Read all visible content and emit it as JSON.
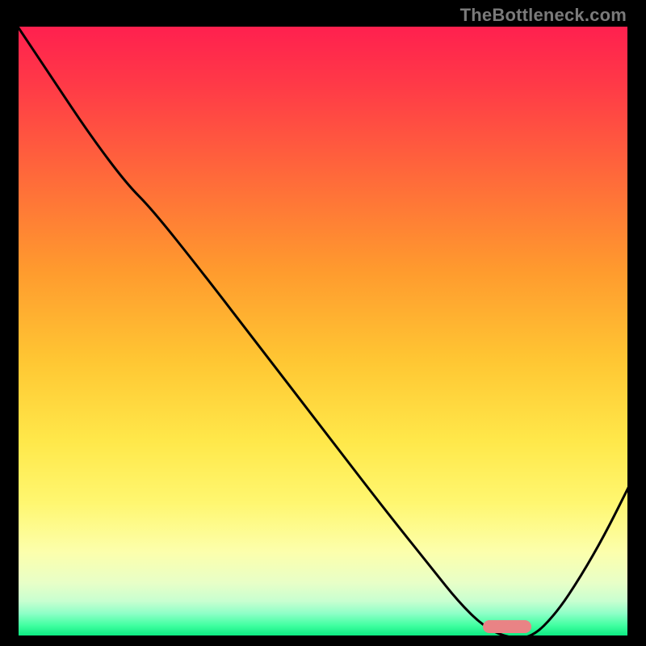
{
  "watermark": "TheBottleneck.com",
  "colors": {
    "curve": "#000000",
    "marker": "#e98385",
    "gradient_top": "#ff1f4f",
    "gradient_bottom": "#00e67a"
  },
  "chart_data": {
    "type": "line",
    "title": "",
    "xlabel": "",
    "ylabel": "",
    "xlim": [
      0,
      100
    ],
    "ylim": [
      0,
      100
    ],
    "grid": false,
    "legend": null,
    "annotations": [
      "TheBottleneck.com"
    ],
    "series": [
      {
        "name": "bottleneck-curve",
        "x": [
          0,
          6,
          12,
          18,
          22,
          30,
          40,
          50,
          60,
          68,
          72,
          76,
          80,
          84,
          88,
          92,
          96,
          100
        ],
        "values": [
          100,
          91,
          82,
          74,
          70,
          60,
          47,
          34,
          21,
          11,
          6,
          2,
          0,
          0,
          4,
          10,
          17,
          25
        ]
      }
    ],
    "marker": {
      "x_start": 76,
      "x_end": 84,
      "y": 0,
      "description": "optimal-range-pill"
    },
    "background_gradient": {
      "direction": "vertical",
      "stops": [
        {
          "pos": 0.0,
          "color": "#ff1f4f"
        },
        {
          "pos": 0.1,
          "color": "#ff3a47"
        },
        {
          "pos": 0.25,
          "color": "#ff6a3a"
        },
        {
          "pos": 0.4,
          "color": "#ff9a2e"
        },
        {
          "pos": 0.55,
          "color": "#ffc733"
        },
        {
          "pos": 0.68,
          "color": "#ffe84a"
        },
        {
          "pos": 0.78,
          "color": "#fff770"
        },
        {
          "pos": 0.86,
          "color": "#fcffac"
        },
        {
          "pos": 0.91,
          "color": "#e8ffc7"
        },
        {
          "pos": 0.94,
          "color": "#c8ffd0"
        },
        {
          "pos": 0.96,
          "color": "#8effc7"
        },
        {
          "pos": 0.98,
          "color": "#3fffa0"
        },
        {
          "pos": 1.0,
          "color": "#00e67a"
        }
      ]
    }
  }
}
